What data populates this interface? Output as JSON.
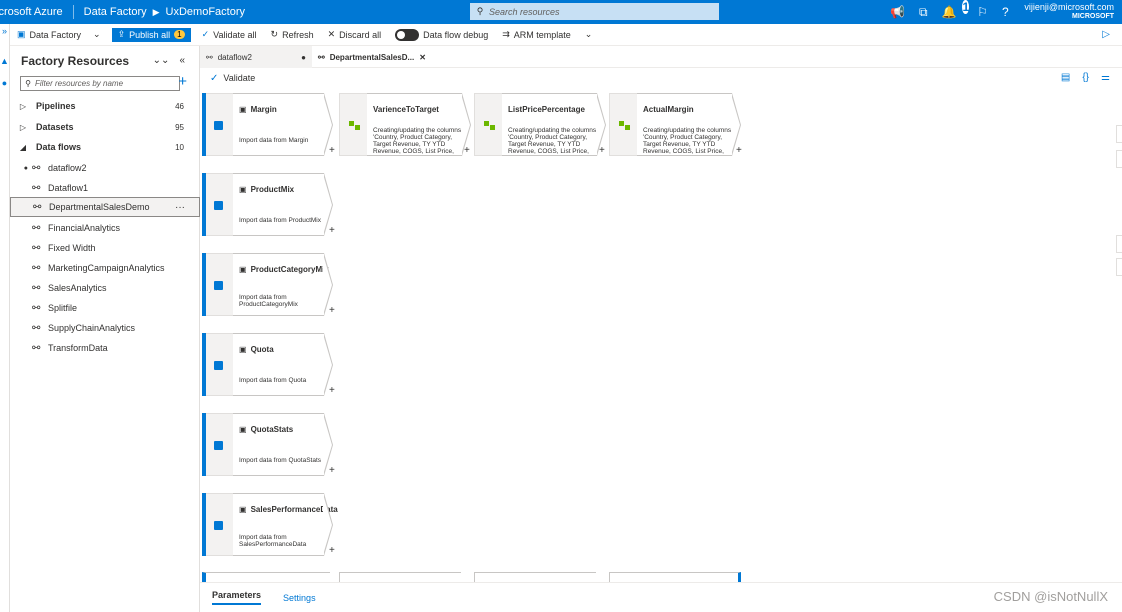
{
  "topbar": {
    "product": "icrosoft Azure",
    "crumb1": "Data Factory",
    "crumb2": "UxDemoFactory",
    "search_placeholder": "Search resources",
    "notif_count": "1",
    "email": "vijienji@microsoft.com",
    "org": "MICROSOFT"
  },
  "toolbar": {
    "factory": "Data Factory",
    "publish": "Publish all",
    "publish_count": "1",
    "validate_all": "Validate all",
    "refresh": "Refresh",
    "discard": "Discard all",
    "debug": "Data flow debug",
    "arm": "ARM template"
  },
  "panel": {
    "title": "Factory Resources",
    "filter_placeholder": "Filter resources by name",
    "categories": [
      {
        "label": "Pipelines",
        "count": "46"
      },
      {
        "label": "Datasets",
        "count": "95"
      },
      {
        "label": "Data flows",
        "count": "10"
      }
    ],
    "flows": [
      "dataflow2",
      "Dataflow1",
      "DepartmentalSalesDemo",
      "FinancialAnalytics",
      "Fixed Width",
      "MarketingCampaignAnalytics",
      "SalesAnalytics",
      "Splitfile",
      "SupplyChainAnalytics",
      "TransformData"
    ]
  },
  "tabs": {
    "tab1": "dataflow2",
    "tab2": "DepartmentalSalesD..."
  },
  "canvas": {
    "validate": "Validate",
    "sources": [
      {
        "title": "Margin",
        "desc": "Import data from Margin"
      },
      {
        "title": "ProductMix",
        "desc": "Import data from ProductMix"
      },
      {
        "title": "ProductCategoryMix",
        "desc": "Import data from ProductCategoryMix"
      },
      {
        "title": "Quota",
        "desc": "Import data from Quota"
      },
      {
        "title": "QuotaStats",
        "desc": "Import data from QuotaStats"
      },
      {
        "title": "SalesPerformanceData",
        "desc": "Import data from SalesPerformanceData"
      }
    ],
    "transforms": [
      {
        "title": "VarienceToTarget",
        "desc": "Creating/updating the columns 'Country, Product Category, Target Revenue, TY YTD Revenue, COGS, List Price, Discount..."
      },
      {
        "title": "ListPricePercentage",
        "desc": "Creating/updating the columns 'Country, Product Category, Target Revenue, TY YTD Revenue, COGS, List Price, Discount..."
      },
      {
        "title": "ActualMargin",
        "desc": "Creating/updating the columns 'Country, Product Category, Target Revenue, TY YTD Revenue, COGS, List Price, Discount..."
      }
    ]
  },
  "bottom": {
    "parameters": "Parameters",
    "settings": "Settings"
  },
  "watermark": "CSDN @isNotNullX"
}
